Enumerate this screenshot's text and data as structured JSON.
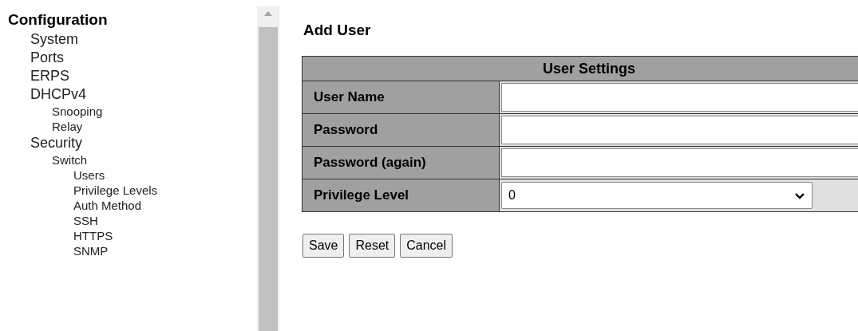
{
  "nav": {
    "title": "Configuration",
    "items": [
      {
        "label": "System"
      },
      {
        "label": "Ports"
      },
      {
        "label": "ERPS"
      },
      {
        "label": "DHCPv4",
        "children": [
          {
            "label": "Snooping"
          },
          {
            "label": "Relay"
          }
        ]
      },
      {
        "label": "Security",
        "children": [
          {
            "label": "Switch",
            "children": [
              {
                "label": "Users"
              },
              {
                "label": "Privilege Levels"
              },
              {
                "label": "Auth Method"
              },
              {
                "label": "SSH"
              },
              {
                "label": "HTTPS"
              },
              {
                "label": "SNMP"
              }
            ]
          }
        ]
      }
    ]
  },
  "page": {
    "title": "Add User",
    "table": {
      "title": "User Settings",
      "rows": [
        {
          "label": "User Name",
          "kind": "text",
          "value": ""
        },
        {
          "label": "Password",
          "kind": "password",
          "value": ""
        },
        {
          "label": "Password (again)",
          "kind": "password",
          "value": ""
        },
        {
          "label": "Privilege Level",
          "kind": "select",
          "value": "0"
        }
      ]
    },
    "buttons": [
      "Save",
      "Reset",
      "Cancel"
    ]
  }
}
